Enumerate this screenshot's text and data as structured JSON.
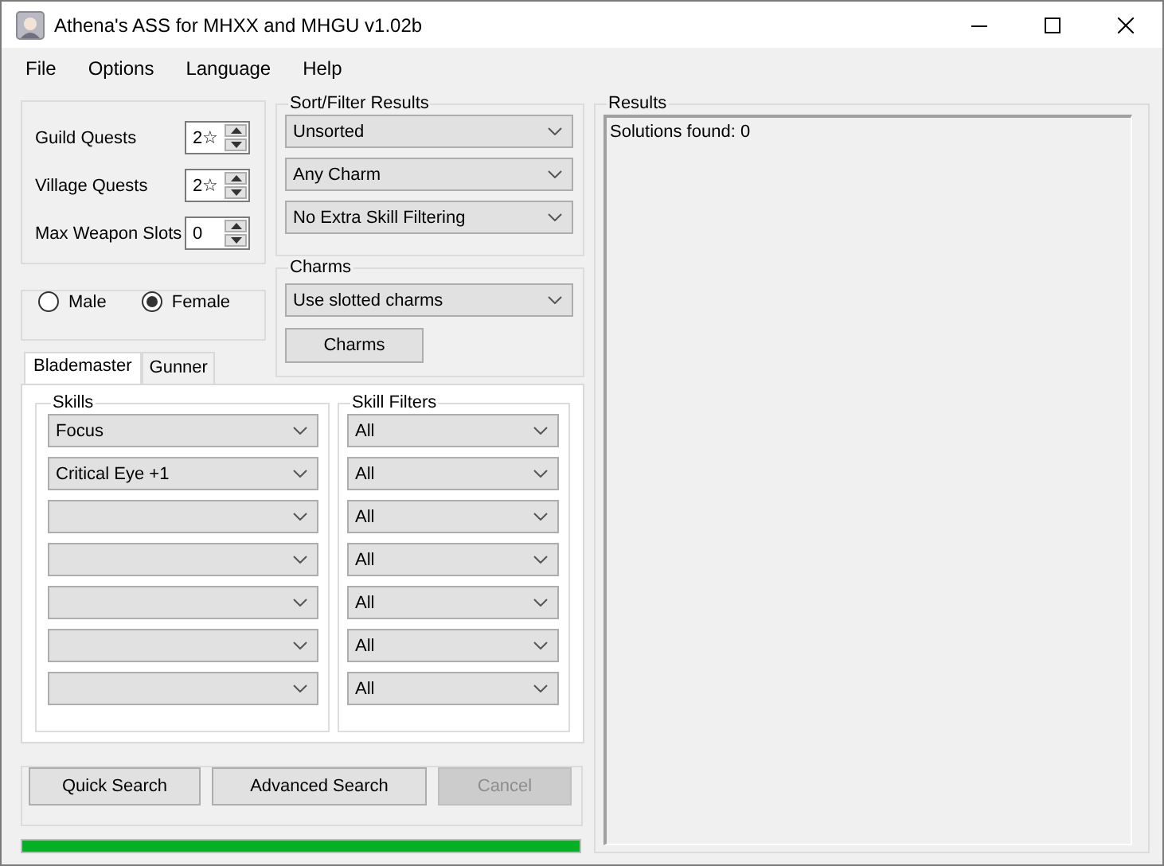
{
  "window": {
    "title": "Athena's ASS for MHXX and MHGU v1.02b"
  },
  "menu": [
    {
      "label": "File"
    },
    {
      "label": "Options"
    },
    {
      "label": "Language"
    },
    {
      "label": "Help"
    }
  ],
  "quests": [
    {
      "label": "Guild Quests",
      "value": "2☆"
    },
    {
      "label": "Village Quests",
      "value": "2☆"
    },
    {
      "label": "Max Weapon Slots",
      "value": "0"
    }
  ],
  "gender": [
    {
      "label": "Male",
      "selected": false
    },
    {
      "label": "Female",
      "selected": true
    }
  ],
  "sort_filter": {
    "title": "Sort/Filter Results",
    "dropdowns": [
      "Unsorted",
      "Any Charm",
      "No Extra Skill Filtering"
    ]
  },
  "charms": {
    "title": "Charms",
    "dropdown": "Use slotted charms",
    "button": "Charms"
  },
  "tabs": [
    {
      "label": "Blademaster",
      "selected": true
    },
    {
      "label": "Gunner",
      "selected": false
    }
  ],
  "skills": {
    "title": "Skills",
    "filters_title": "Skill Filters",
    "rows": [
      {
        "skill": "Focus",
        "filter": "All"
      },
      {
        "skill": "Critical Eye +1",
        "filter": "All"
      },
      {
        "filter": "All"
      },
      {
        "filter": "All"
      },
      {
        "filter": "All"
      },
      {
        "filter": "All"
      },
      {
        "filter": "All"
      }
    ]
  },
  "buttons": [
    {
      "label": "Quick Search",
      "disabled": false
    },
    {
      "label": "Advanced Search",
      "disabled": false
    },
    {
      "label": "Cancel",
      "disabled": true
    }
  ],
  "progress": {
    "level": 1
  },
  "results": {
    "title": "Results",
    "text": "Solutions found: 0"
  }
}
